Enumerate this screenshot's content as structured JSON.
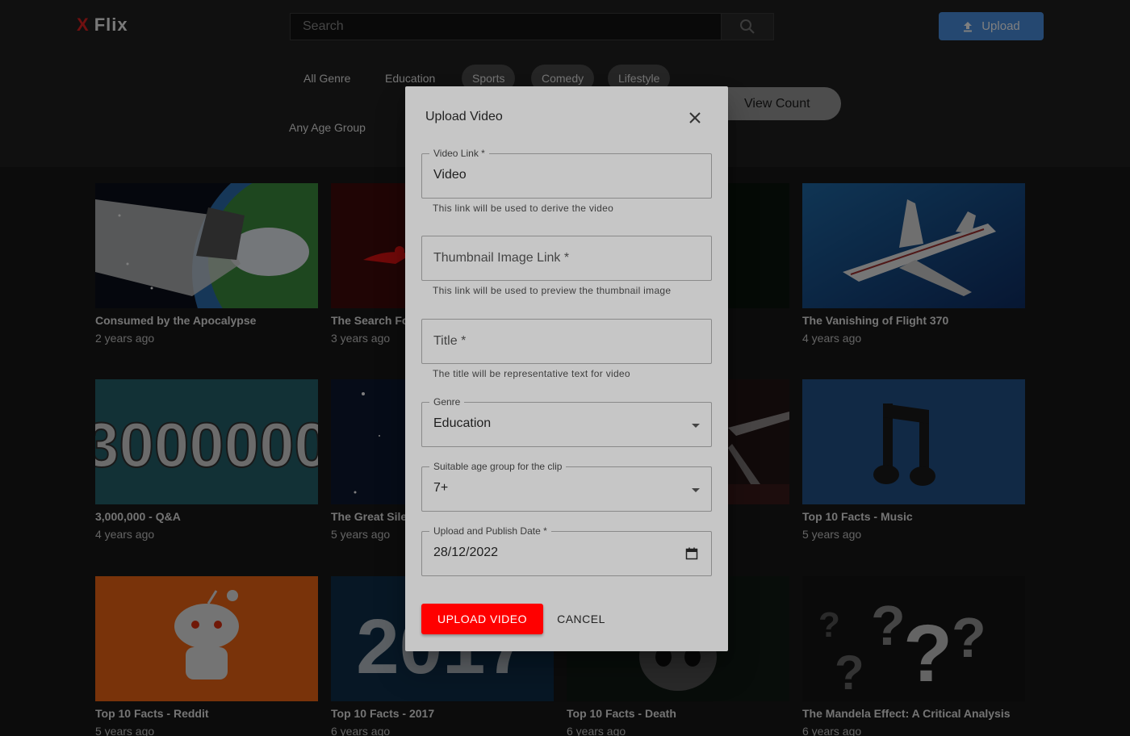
{
  "header": {
    "logo_x": "X",
    "logo_flix": "Flix",
    "search_placeholder": "Search",
    "upload_label": "Upload"
  },
  "genres": [
    "All Genre",
    "Education",
    "Sports",
    "Comedy",
    "Lifestyle"
  ],
  "age_filter_label": "Any Age Group",
  "sort_label": "View Count",
  "videos": [
    {
      "title": "Consumed by the Apocalypse",
      "date": "2 years ago"
    },
    {
      "title": "The Search For",
      "date": "3 years ago"
    },
    {
      "title": "",
      "date": ""
    },
    {
      "title": "The Vanishing of Flight 370",
      "date": "4 years ago"
    },
    {
      "title": "3,000,000 - Q&A",
      "date": "4 years ago"
    },
    {
      "title": "The Great Silen",
      "date": "5 years ago"
    },
    {
      "title": "",
      "date": ""
    },
    {
      "title": "Top 10 Facts - Music",
      "date": "5 years ago"
    },
    {
      "title": "Top 10 Facts - Reddit",
      "date": "5 years ago"
    },
    {
      "title": "Top 10 Facts - 2017",
      "date": "6 years ago"
    },
    {
      "title": "Top 10 Facts - Death",
      "date": "6 years ago"
    },
    {
      "title": "The Mandela Effect: A Critical Analysis",
      "date": "6 years ago"
    }
  ],
  "thumb_texts": {
    "big_number": "3000000",
    "year": "2017"
  },
  "dialog": {
    "title": "Upload Video",
    "video_link": {
      "label": "Video Link *",
      "value": "Video",
      "helper": "This link will be used to derive the video"
    },
    "thumbnail": {
      "placeholder": "Thumbnail Image Link *",
      "helper": "This link will be used to preview the thumbnail image"
    },
    "title_field": {
      "placeholder": "Title *",
      "helper": "The title will be representative text for video"
    },
    "genre": {
      "label": "Genre",
      "value": "Education"
    },
    "age_group": {
      "label": "Suitable age group for the clip",
      "value": "7+"
    },
    "date": {
      "label": "Upload and Publish Date *",
      "value": "28/12/2022"
    },
    "upload_button": "UPLOAD VIDEO",
    "cancel_button": "CANCEL"
  }
}
